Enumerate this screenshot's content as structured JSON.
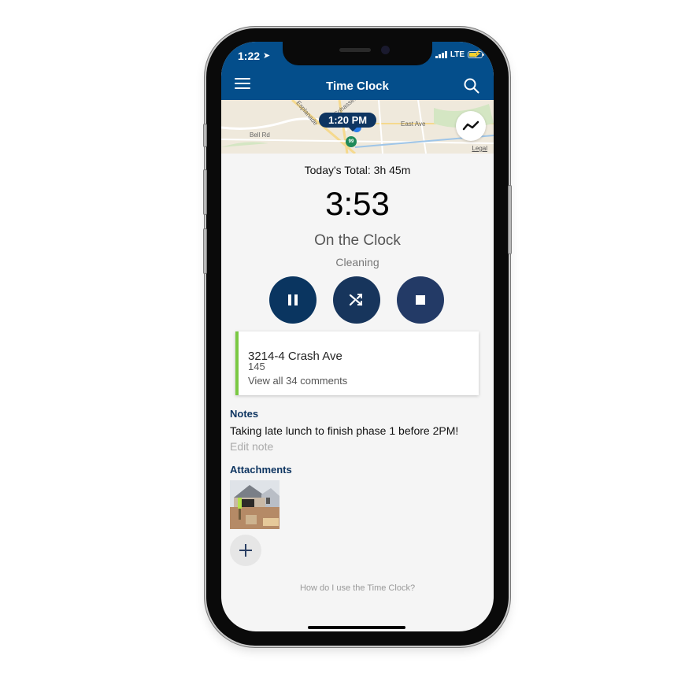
{
  "status_bar": {
    "time": "1:22",
    "network": "LTE",
    "location_icon": "location-arrow-icon",
    "battery_icon": "battery-charging-icon",
    "signal_icon": "signal-bars-icon"
  },
  "header": {
    "title": "Time Clock",
    "menu_icon": "hamburger-menu-icon",
    "search_icon": "search-icon"
  },
  "map": {
    "pin_time": "1:20 PM",
    "labels": [
      "Esplanade",
      "Cohasset",
      "East Ave",
      "Bell Rd"
    ],
    "highway_shield": "99",
    "legal_link": "Legal",
    "trend_button_icon": "trend-line-icon"
  },
  "clock": {
    "today_total": "Today's Total: 3h 45m",
    "timer": "3:53",
    "status": "On the Clock",
    "activity": "Cleaning"
  },
  "controls": [
    {
      "name": "pause",
      "icon": "pause-icon",
      "color": "#0a3560"
    },
    {
      "name": "switch",
      "icon": "shuffle-icon",
      "color": "#17355c"
    },
    {
      "name": "stop",
      "icon": "stop-icon",
      "color": "#233a66"
    }
  ],
  "job_card": {
    "title": "3214-4 Crash Ave",
    "subtitle": "145",
    "comments_link": "View all 34 comments",
    "accent_color": "#7ac943"
  },
  "notes": {
    "label": "Notes",
    "text": "Taking late lunch to finish phase 1 before 2PM!",
    "edit_link": "Edit note"
  },
  "attachments": {
    "label": "Attachments",
    "items": [
      {
        "type": "photo",
        "description": "house construction site"
      }
    ],
    "add_icon": "plus-icon"
  },
  "help_link": "How do I use the Time Clock?",
  "colors": {
    "header_bg": "#044e8b",
    "section_label": "#0e3561",
    "screen_bg": "#f5f5f5"
  }
}
